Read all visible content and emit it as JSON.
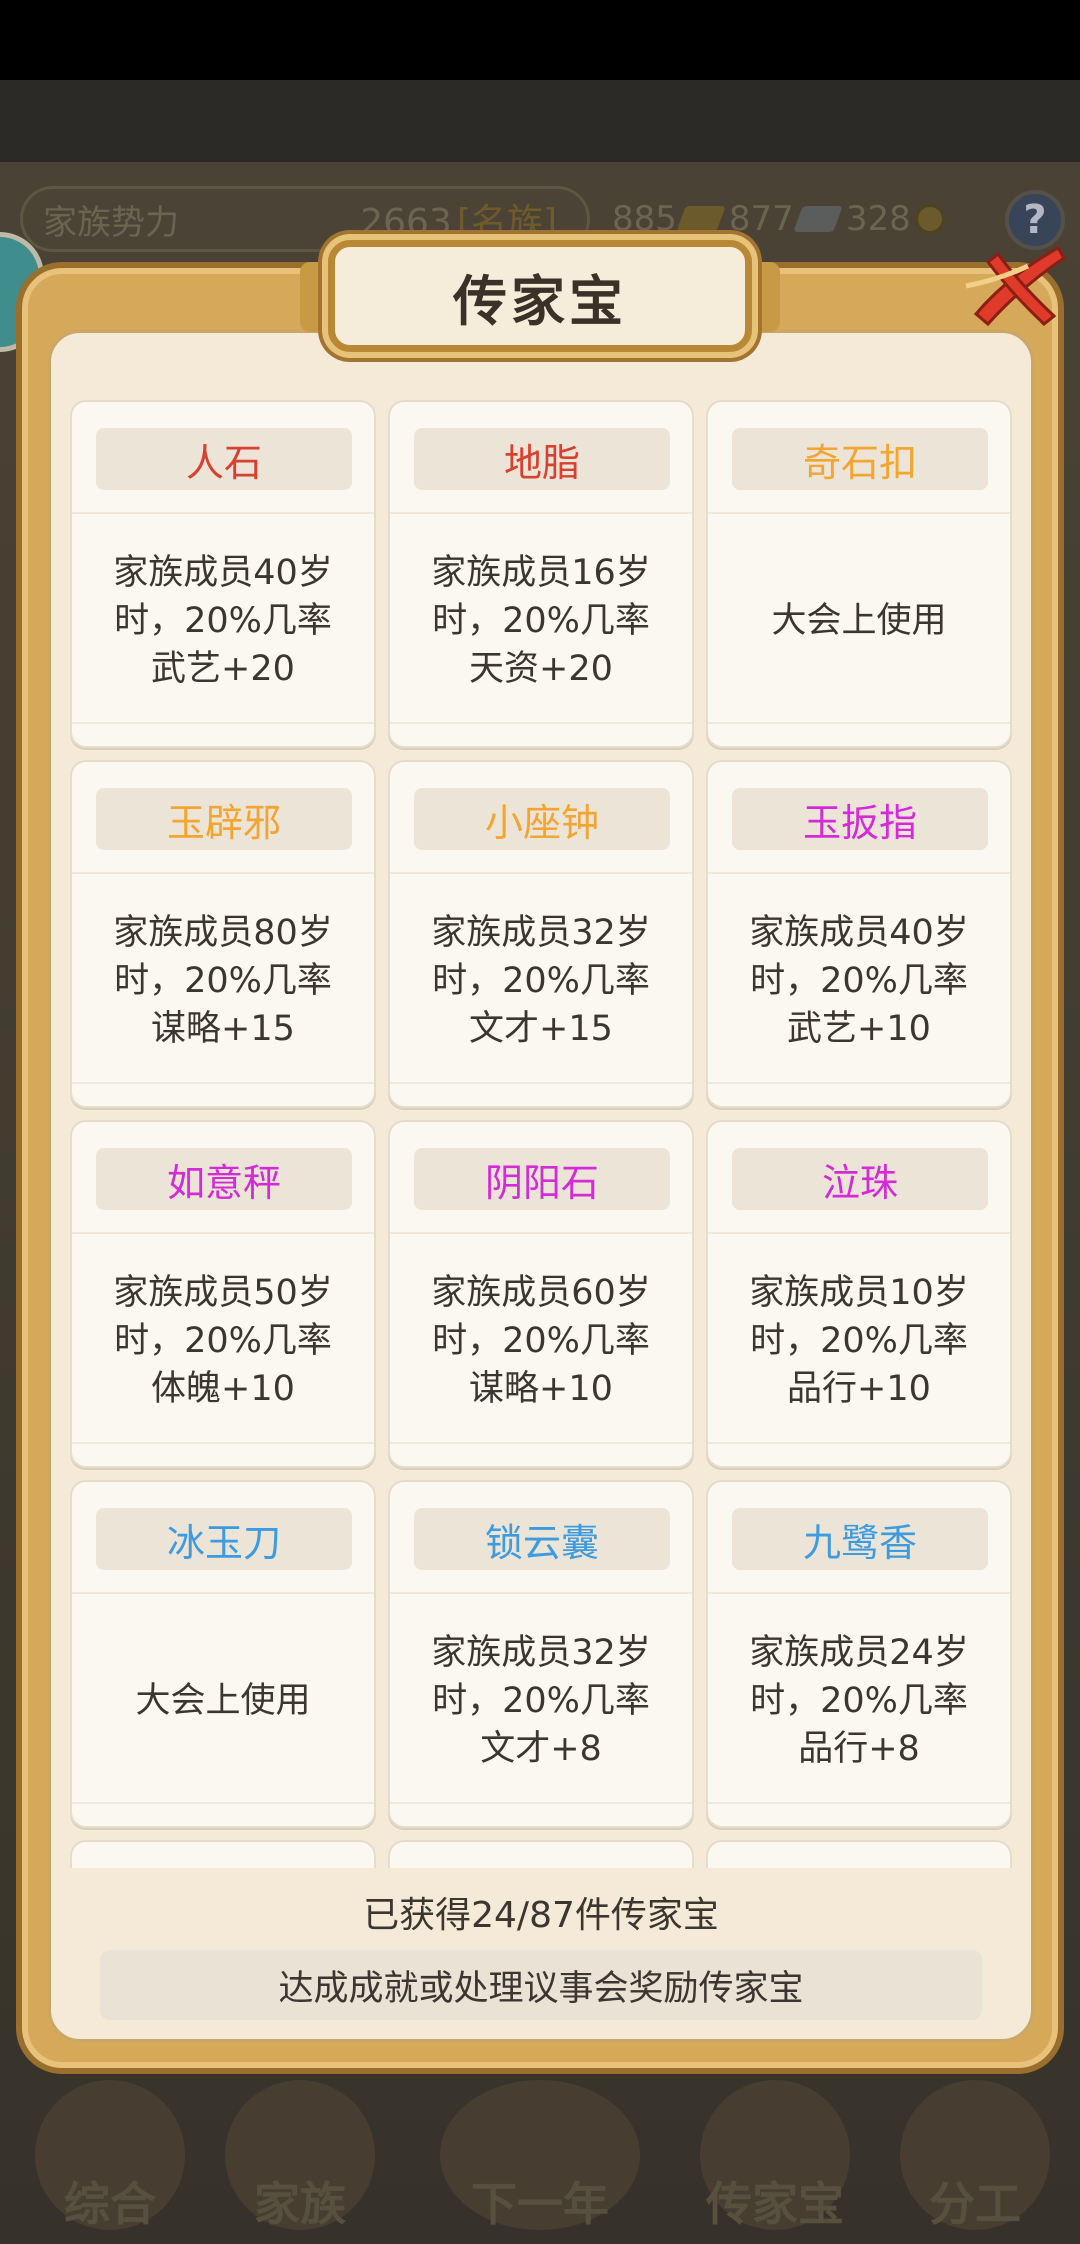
{
  "header": {
    "influence_label": "家族势力",
    "influence_value": "2663",
    "influence_rank": "[名族]",
    "resources": [
      {
        "value": "885",
        "icon": "gold-ingot-icon"
      },
      {
        "value": "877",
        "icon": "silver-ingot-icon"
      },
      {
        "value": "328",
        "icon": "copper-coin-icon"
      }
    ],
    "help": "?"
  },
  "modal": {
    "title": "传家宝",
    "items": [
      {
        "name": "人石",
        "color": "#d8402f",
        "desc": "家族成员40岁\n时，20%几率\n武艺+20"
      },
      {
        "name": "地脂",
        "color": "#d8402f",
        "desc": "家族成员16岁\n时，20%几率\n天资+20"
      },
      {
        "name": "奇石扣",
        "color": "#f3a531",
        "desc": "大会上使用"
      },
      {
        "name": "玉辟邪",
        "color": "#f3a531",
        "desc": "家族成员80岁\n时，20%几率\n谋略+15"
      },
      {
        "name": "小座钟",
        "color": "#f3a531",
        "desc": "家族成员32岁\n时，20%几率\n文才+15"
      },
      {
        "name": "玉扳指",
        "color": "#d42bd8",
        "desc": "家族成员40岁\n时，20%几率\n武艺+10"
      },
      {
        "name": "如意秤",
        "color": "#d42bd8",
        "desc": "家族成员50岁\n时，20%几率\n体魄+10"
      },
      {
        "name": "阴阳石",
        "color": "#d42bd8",
        "desc": "家族成员60岁\n时，20%几率\n谋略+10"
      },
      {
        "name": "泣珠",
        "color": "#d42bd8",
        "desc": "家族成员10岁\n时，20%几率\n品行+10"
      },
      {
        "name": "冰玉刀",
        "color": "#3d9be0",
        "desc": "大会上使用"
      },
      {
        "name": "锁云囊",
        "color": "#3d9be0",
        "desc": "家族成员32岁\n时，20%几率\n文才+8"
      },
      {
        "name": "九鹭香",
        "color": "#3d9be0",
        "desc": "家族成员24岁\n时，20%几率\n品行+8"
      }
    ],
    "count_text": "已获得24/87件传家宝",
    "hint_text": "达成成就或处理议事会奖励传家宝"
  },
  "bottom_nav": [
    {
      "label": "综合"
    },
    {
      "label": "家族"
    },
    {
      "label": "下一年"
    },
    {
      "label": "传家宝"
    },
    {
      "label": "分工"
    }
  ]
}
